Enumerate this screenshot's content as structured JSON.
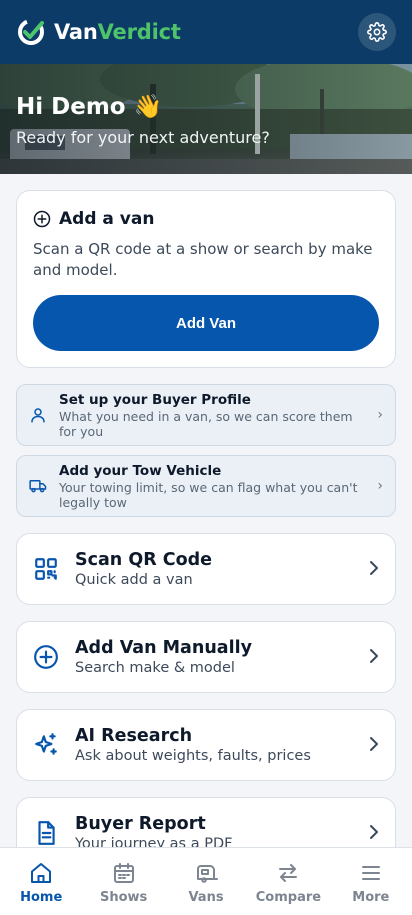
{
  "header": {
    "brand_part1": "Van",
    "brand_part2": "Verdict",
    "settings_icon": "gear-icon"
  },
  "hero": {
    "greeting": "Hi Demo 👋",
    "subtitle": "Ready for your next adventure?"
  },
  "add_van_card": {
    "title": "Add a van",
    "description": "Scan a QR code at a show or search by make and model.",
    "button_label": "Add Van"
  },
  "setup_items": [
    {
      "title": "Set up your Buyer Profile",
      "subtitle": "What you need in a van, so we can score them for you",
      "icon": "person-icon",
      "chevron": "›"
    },
    {
      "title": "Add your Tow Vehicle",
      "subtitle": "Your towing limit, so we can flag what you can't legally tow",
      "icon": "truck-icon",
      "chevron": "›"
    }
  ],
  "actions": [
    {
      "title": "Scan QR Code",
      "subtitle": "Quick add a van",
      "icon": "qr-code-icon"
    },
    {
      "title": "Add Van Manually",
      "subtitle": "Search make & model",
      "icon": "plus-circle-icon"
    },
    {
      "title": "AI Research",
      "subtitle": "Ask about weights, faults, prices",
      "icon": "sparkles-icon"
    },
    {
      "title": "Buyer Report",
      "subtitle": "Your journey as a PDF",
      "icon": "document-icon"
    }
  ],
  "bottom_nav": {
    "active": "Home",
    "items": [
      {
        "label": "Home",
        "icon": "home-icon"
      },
      {
        "label": "Shows",
        "icon": "calendar-icon"
      },
      {
        "label": "Vans",
        "icon": "caravan-icon"
      },
      {
        "label": "Compare",
        "icon": "compare-arrows-icon"
      },
      {
        "label": "More",
        "icon": "menu-icon"
      }
    ]
  },
  "colors": {
    "header_bg": "#0b3b66",
    "brand_green": "#4fc36a",
    "primary_blue": "#0756ad",
    "page_bg": "#f3f5f8"
  }
}
